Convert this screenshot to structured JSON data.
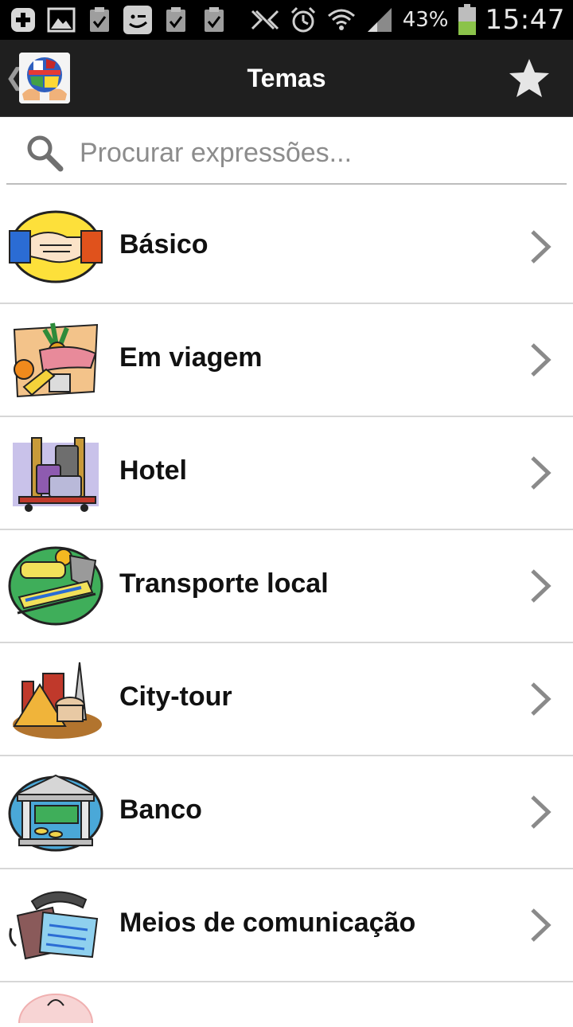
{
  "status_bar": {
    "battery": "43%",
    "time": "15:47",
    "icons": [
      "add-icon",
      "image-icon",
      "clipboard-icon",
      "messenger-icon",
      "clipboard-icon",
      "clipboard-icon",
      "nfc-icon",
      "alarm-icon",
      "wifi-icon",
      "signal-icon",
      "battery-icon"
    ]
  },
  "action_bar": {
    "title": "Temas",
    "logo": "globe-hands-logo",
    "favorite": "star-icon"
  },
  "search": {
    "placeholder": "Procurar expressões..."
  },
  "topics": [
    {
      "label": "Básico",
      "icon": "handshake-icon"
    },
    {
      "label": "Em viagem",
      "icon": "travel-icon"
    },
    {
      "label": "Hotel",
      "icon": "luggage-cart-icon"
    },
    {
      "label": "Transporte local",
      "icon": "train-icon"
    },
    {
      "label": "City-tour",
      "icon": "landmarks-icon"
    },
    {
      "label": "Banco",
      "icon": "bank-icon"
    },
    {
      "label": "Meios de comunicação",
      "icon": "telephone-icon"
    }
  ],
  "colors": {
    "status_bar": "#000000",
    "action_bar": "#1f1f1f",
    "divider": "#d7d7d7",
    "battery_fill": "#8bc34a"
  }
}
